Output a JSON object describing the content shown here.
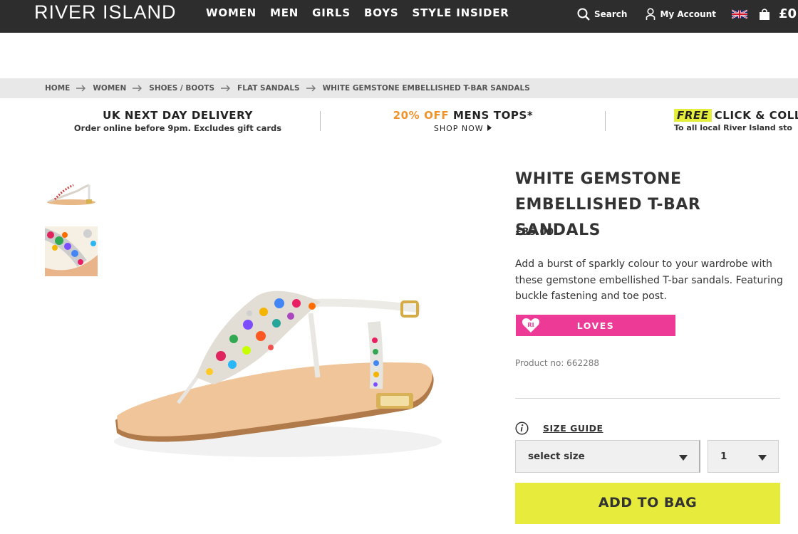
{
  "header": {
    "logo": "RIVER ISLAND",
    "nav": [
      "WOMEN",
      "MEN",
      "GIRLS",
      "BOYS",
      "STYLE INSIDER"
    ],
    "search_label": "Search",
    "account_label": "My Account",
    "bag_total": "£0"
  },
  "breadcrumb": [
    "HOME",
    "WOMEN",
    "SHOES / BOOTS",
    "FLAT SANDALS",
    "WHITE GEMSTONE EMBELLISHED T-BAR SANDALS"
  ],
  "promos": {
    "delivery": {
      "title": "UK NEXT DAY DELIVERY",
      "subtitle": "Order online before 9pm. Excludes gift cards"
    },
    "offer": {
      "accent": "20% OFF",
      "title": "MENS TOPS*",
      "cta": "SHOP NOW"
    },
    "collect": {
      "tag": "FREE",
      "title": "CLICK & COLLE",
      "subtitle": "To all local River Island sto"
    }
  },
  "product": {
    "title": "WHITE GEMSTONE EMBELLISHED T-BAR SANDALS",
    "price": "£35.00",
    "description": "Add a burst of sparkly colour to your wardrobe with these gemstone embellished T-bar sandals. Featuring buckle fastening and toe post.",
    "loves_label": "LOVES",
    "loves_badge": "RI",
    "product_no": "Product no: 662288",
    "size_guide": "SIZE GUIDE",
    "size_placeholder": "select size",
    "quantity": "1",
    "add_to_bag": "ADD TO BAG"
  },
  "colors": {
    "header_bg": "#2d2d2d",
    "accent_orange": "#f0932b",
    "loves_pink": "#ec3a96",
    "add_to_bag": "#e6eb3c",
    "free_tag": "#e5ee3a"
  }
}
